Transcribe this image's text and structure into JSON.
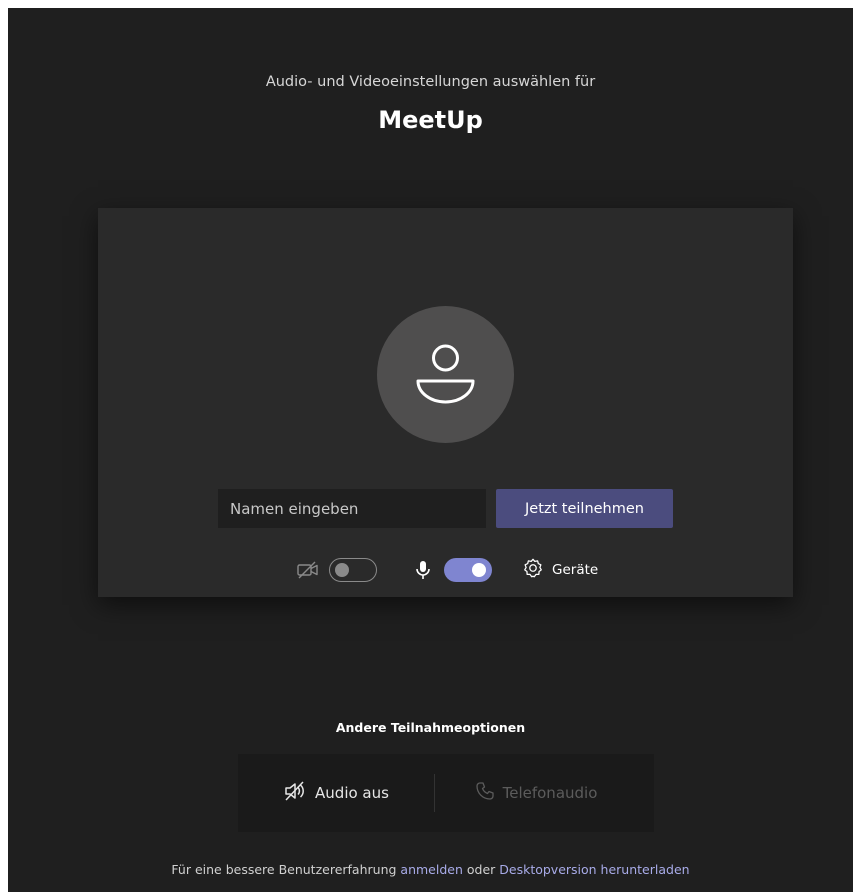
{
  "header": {
    "subtitle": "Audio- und Videoeinstellungen auswählen für",
    "meeting_title": "MeetUp"
  },
  "preview": {
    "avatar_icon": "person-icon",
    "name_placeholder": "Namen eingeben",
    "join_label": "Jetzt teilnehmen"
  },
  "controls": {
    "camera_icon": "camera-off-icon",
    "camera_enabled": false,
    "mic_icon": "microphone-icon",
    "mic_enabled": true,
    "devices_icon": "gear-icon",
    "devices_label": "Geräte"
  },
  "other_options": {
    "title": "Andere Teilnahmeoptionen",
    "audio_off_icon": "speaker-off-icon",
    "audio_off_label": "Audio aus",
    "phone_icon": "phone-icon",
    "phone_label": "Telefonaudio"
  },
  "footer": {
    "prefix": "Für eine bessere Benutzererfahrung ",
    "sign_in_link": "anmelden",
    "middle": " oder ",
    "download_link": "Desktopversion herunterladen"
  },
  "colors": {
    "background": "#1f1f1f",
    "card": "#2a2a2a",
    "accent": "#4b4c7e",
    "toggle_on": "#7f85d0",
    "link": "#a8abe8"
  }
}
